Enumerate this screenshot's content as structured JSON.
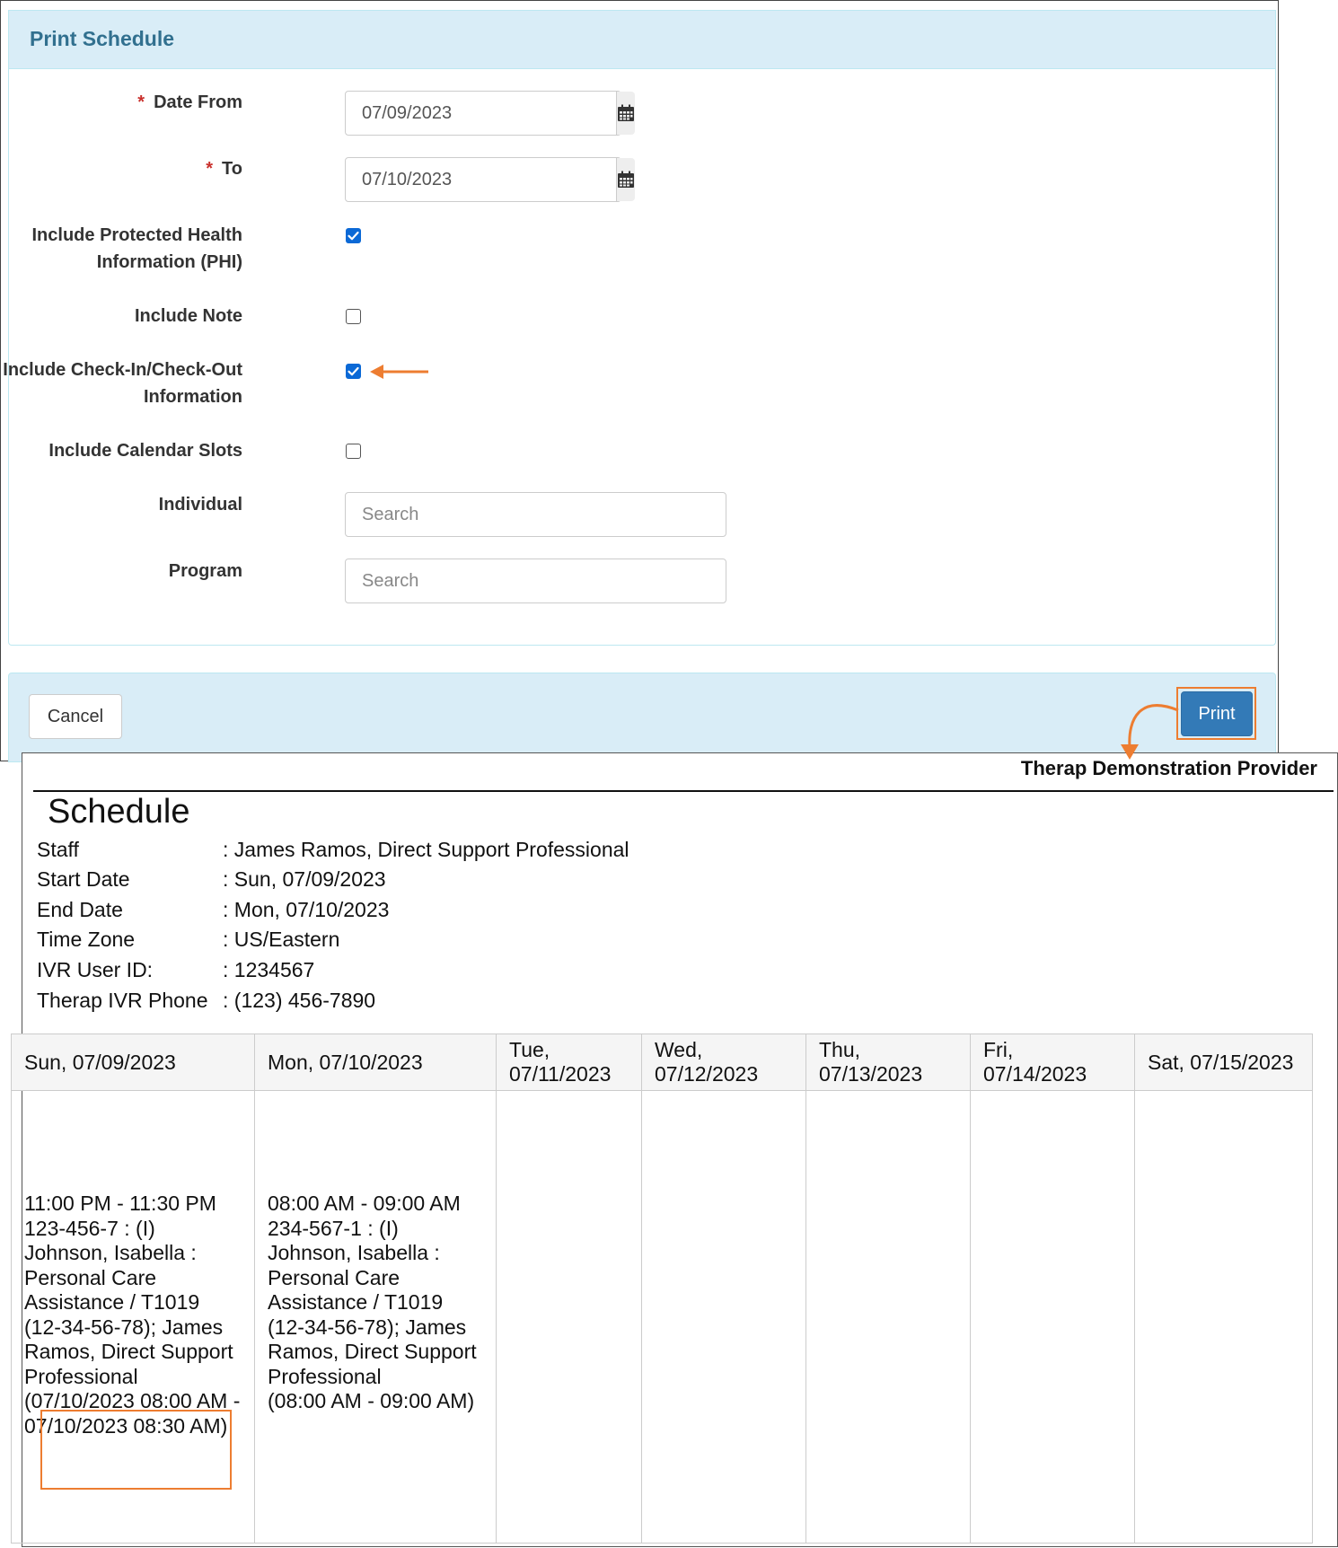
{
  "dialog": {
    "title": "Print Schedule",
    "fields": {
      "date_from": {
        "label": "Date From",
        "value": "07/09/2023"
      },
      "date_to": {
        "label": "To",
        "value": "07/10/2023"
      },
      "required_mark": "*",
      "include_phi": {
        "label": "Include Protected Health Information (PHI)",
        "checked": true
      },
      "include_note": {
        "label": "Include Note",
        "checked": false
      },
      "include_checkin": {
        "label": "Include Check-In/Check-Out Information",
        "checked": true
      },
      "include_slots": {
        "label": "Include Calendar Slots",
        "checked": false
      },
      "individual": {
        "label": "Individual",
        "placeholder": "Search"
      },
      "program": {
        "label": "Program",
        "placeholder": "Search"
      }
    },
    "footer": {
      "cancel_label": "Cancel",
      "print_label": "Print"
    }
  },
  "report": {
    "provider": "Therap Demonstration Provider",
    "title": "Schedule",
    "info": [
      {
        "key": "Staff",
        "value": ": James Ramos, Direct Support Professional"
      },
      {
        "key": "Start Date",
        "value": ": Sun, 07/09/2023"
      },
      {
        "key": "End Date",
        "value": ": Mon, 07/10/2023"
      },
      {
        "key": "Time Zone",
        "value": ": US/Eastern"
      },
      {
        "key": "IVR User ID:",
        "value": ": 1234567"
      },
      {
        "key": "Therap IVR Phone",
        "value": ": (123) 456-7890"
      }
    ],
    "days": [
      "Sun, 07/09/2023",
      "Mon, 07/10/2023",
      "Tue, 07/11/2023",
      "Wed, 07/12/2023",
      "Thu, 07/13/2023",
      "Fri, 07/14/2023",
      "Sat, 07/15/2023"
    ],
    "appointments": {
      "sun": {
        "time": "11:00 PM - 11:30 PM",
        "details": "123-456-7 : (I) Johnson, Isabella : Personal Care Assistance / T1019 (12-34-56-78); James Ramos, Direct Support Professional",
        "checkin": "(07/10/2023 08:00 AM - 07/10/2023 08:30 AM)"
      },
      "mon": {
        "time": "08:00 AM - 09:00 AM",
        "details": "234-567-1 : (I) Johnson, Isabella : Personal Care Assistance / T1019 (12-34-56-78); James Ramos, Direct Support Professional",
        "checkin": "(08:00 AM - 09:00 AM)"
      }
    }
  },
  "colors": {
    "accent": "#ed7d31",
    "header_bg": "#d9edf7",
    "title_text": "#31708f",
    "primary": "#337ab7",
    "checkbox": "#0b69d6"
  }
}
